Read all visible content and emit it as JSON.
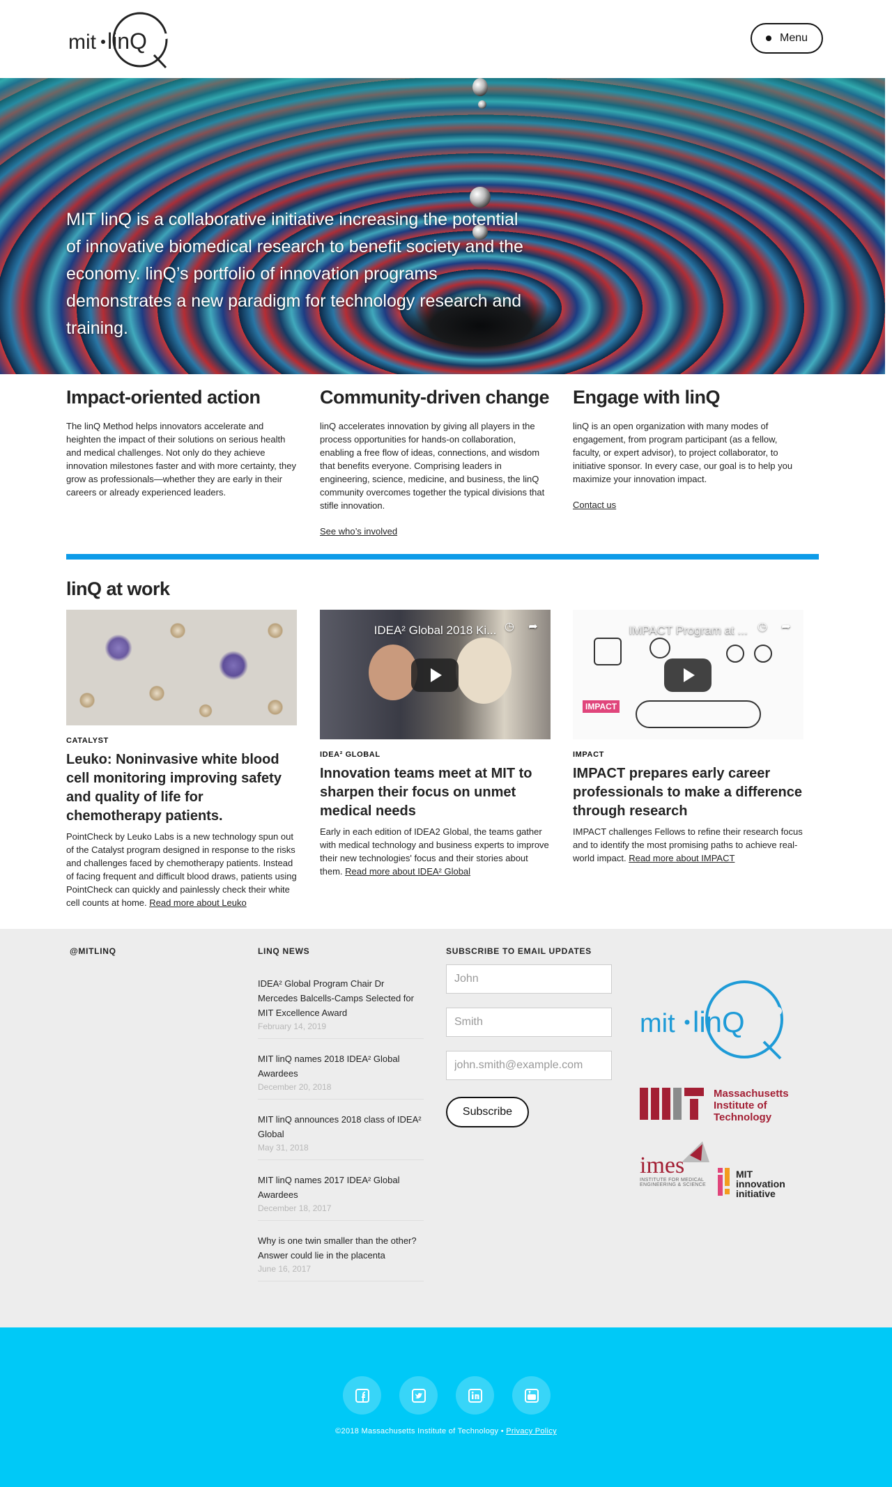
{
  "header": {
    "logo_text": "mit·linQ",
    "menu_label": "Menu"
  },
  "hero": {
    "text": "MIT linQ is a collaborative initiative increasing the potential of innovative biomedical research to benefit society and the economy. linQ’s portfolio of innovation programs demonstrates a new paradigm for technology research and training."
  },
  "columns": [
    {
      "title": "Impact-oriented action",
      "body": "The linQ Method helps innovators accelerate and heighten the impact of their solutions on serious health and medical challenges. Not only do they achieve innovation milestones faster and with more certainty, they grow as professionals—whether they are early in their careers or already experienced leaders.",
      "link": ""
    },
    {
      "title": "Community-driven change",
      "body": "linQ accelerates innovation by giving all players in the process opportunities for hands-on collaboration, enabling a free flow of ideas, connections, and wisdom that benefits everyone. Comprising leaders in engineering, science, medicine, and business, the linQ community overcomes together the typical divisions that stifle innovation.",
      "link": "See who’s involved"
    },
    {
      "title": "Engage with linQ",
      "body": "linQ is an open organization with many modes of engagement, from program participant (as a fellow, faculty, or expert advisor), to project collaborator, to initiative sponsor. In every case, our goal is to help you maximize your innovation impact.",
      "link": "Contact us"
    }
  ],
  "work": {
    "title": "linQ at work",
    "cards": [
      {
        "tag": "CATALYST",
        "title": "Leuko: Noninvasive white blood cell monitoring improving safety and quality of life for chemotherapy patients.",
        "body": "PointCheck by Leuko Labs is a new technology spun out of the Catalyst program designed in response to the risks and challenges faced by chemotherapy patients. Instead of facing frequent and difficult blood draws, patients using PointCheck can quickly and painlessly check their white cell counts at home. ",
        "link": "Read more about Leuko"
      },
      {
        "tag": "IDEA² GLOBAL",
        "video_title": "IDEA² Global 2018 Ki...",
        "title": "Innovation teams meet at MIT to sharpen their focus on unmet medical needs",
        "body": "Early in each edition of IDEA2 Global, the teams gather with medical technology and business experts to improve their new technologies' focus and their stories about them. ",
        "link": "Read more about IDEA² Global"
      },
      {
        "tag": "IMPACT",
        "video_title": "IMPACT Program at ...",
        "video_badge": "IMPACT",
        "title": "IMPACT prepares early career professionals to make a difference through research",
        "body": "IMPACT challenges Fellows to refine their research focus and to identify the most promising paths to achieve real-world impact. ",
        "link": "Read more about IMPACT"
      }
    ]
  },
  "sidebar_heads": {
    "twitter": "@MITLINQ",
    "news": "LINQ NEWS",
    "subscribe": "SUBSCRIBE TO EMAIL UPDATES"
  },
  "news": [
    {
      "title": "IDEA² Global Program Chair Dr Mercedes Balcells-Camps Selected for MIT Excellence Award",
      "date": "February 14, 2019"
    },
    {
      "title": "MIT linQ names 2018 IDEA² Global Awardees",
      "date": "December 20, 2018"
    },
    {
      "title": "MIT linQ announces 2018 class of IDEA² Global",
      "date": "May 31, 2018"
    },
    {
      "title": "MIT linQ names 2017 IDEA² Global Awardees",
      "date": "December 18, 2017"
    },
    {
      "title": "Why is one twin smaller than the other? Answer could lie in the placenta",
      "date": "June 16, 2017"
    }
  ],
  "form": {
    "first_placeholder": "John",
    "last_placeholder": "Smith",
    "email_placeholder": "john.smith@example.com",
    "submit_label": "Subscribe"
  },
  "partners": {
    "mit_line1": "Massachusetts",
    "mit_line2": "Institute of",
    "mit_line3": "Technology",
    "imes_name": "imes",
    "imes_sub1": "INSTITUTE FOR MEDICAL",
    "imes_sub2": "ENGINEERING & SCIENCE",
    "mii_line1": "MIT",
    "mii_line2": "innovation",
    "mii_line3": "initiative"
  },
  "footer": {
    "copyright": "©2018 Massachusetts Institute of Technology • ",
    "privacy": "Privacy Policy",
    "socials": [
      "facebook-icon",
      "twitter-icon",
      "linkedin-icon",
      "youtube-icon"
    ]
  },
  "colors": {
    "accent_blue": "#0d9be8",
    "footer_cyan": "#00c9f7",
    "mit_red": "#a31f34",
    "linq_blue": "#1e9bd7"
  }
}
